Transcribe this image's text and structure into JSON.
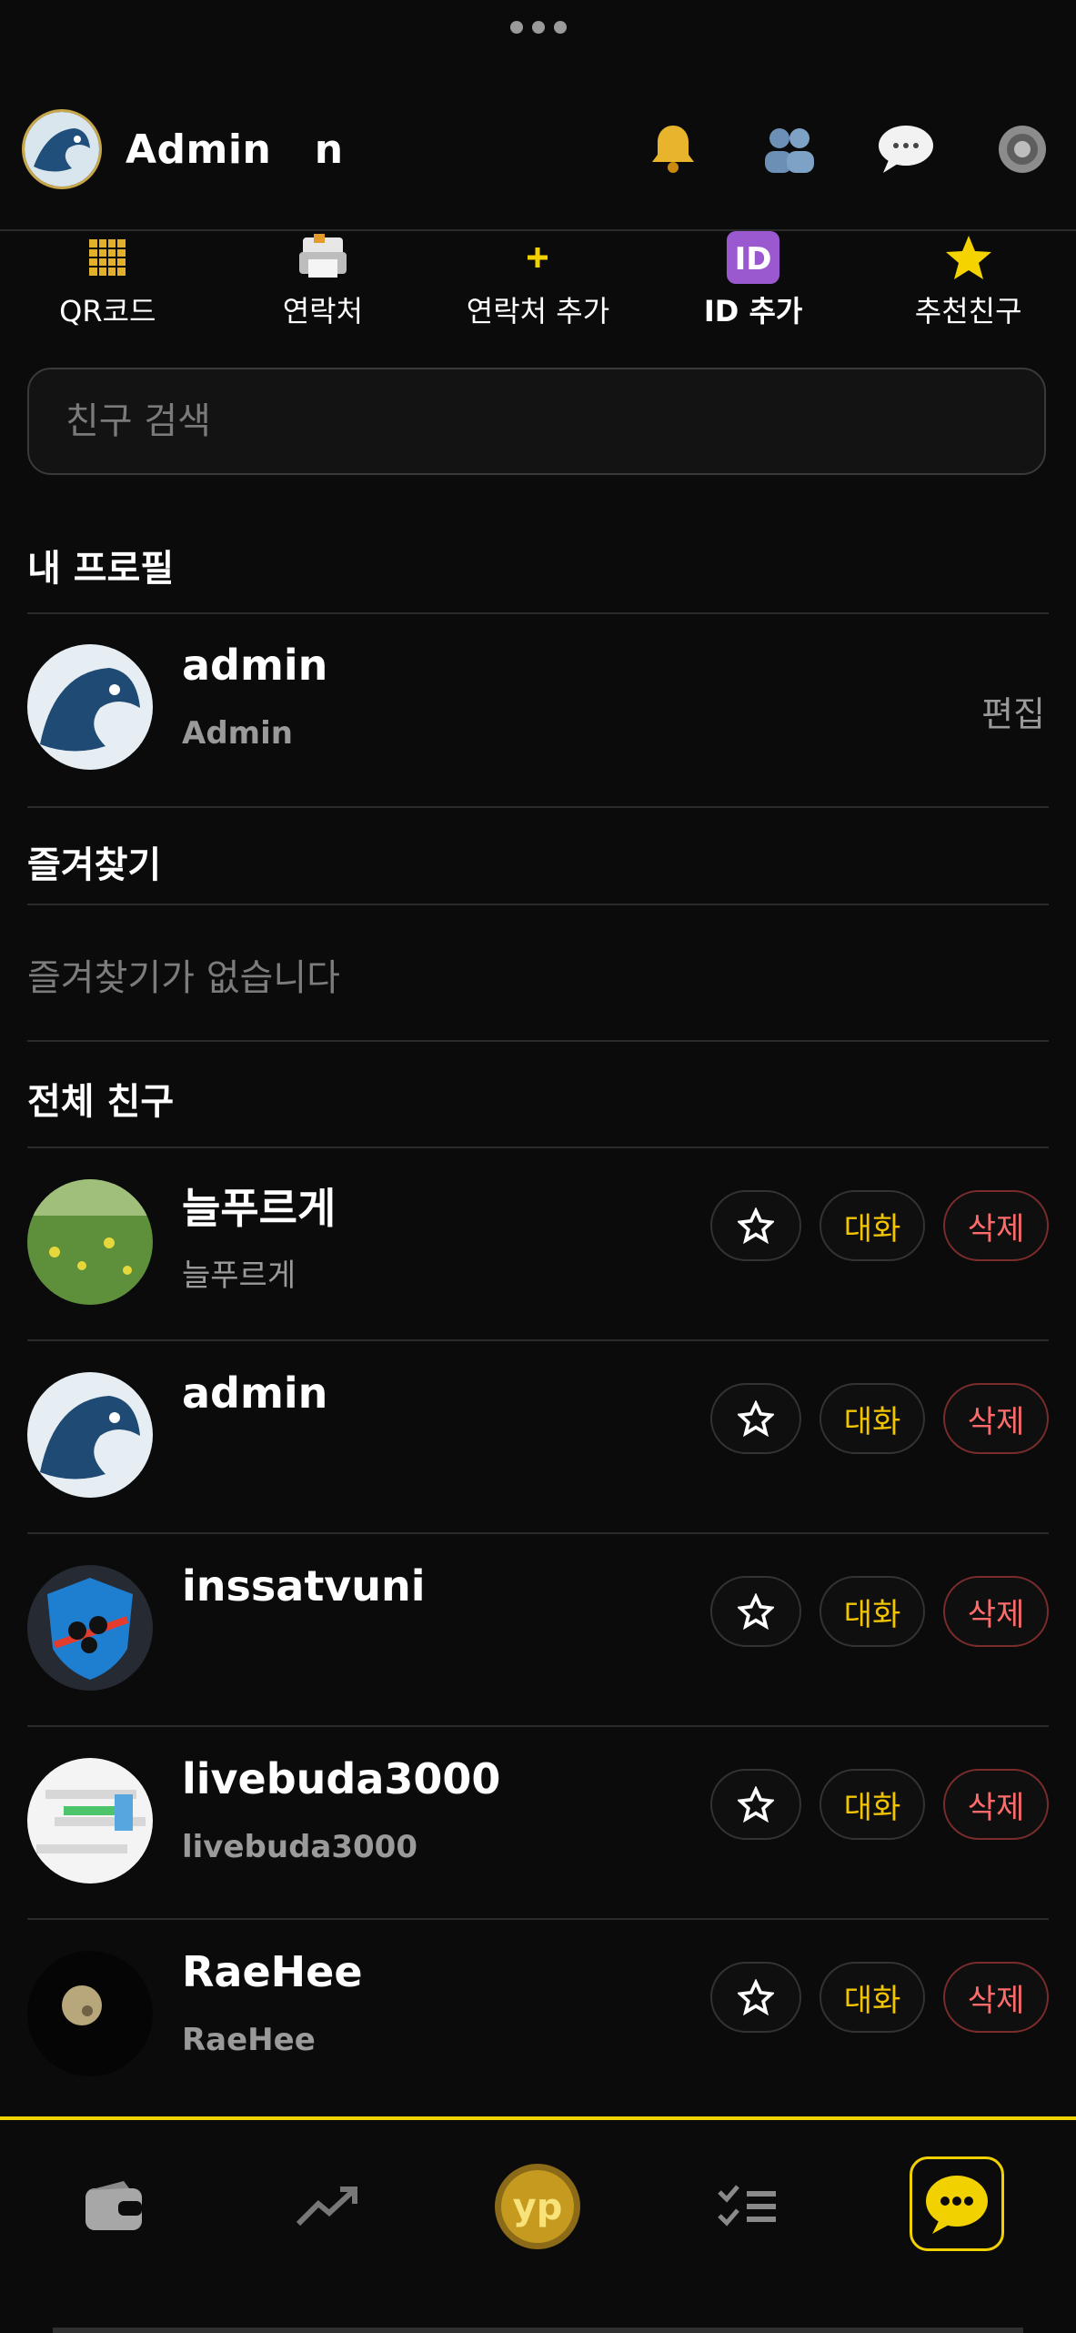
{
  "header": {
    "title": "Admin   n"
  },
  "quick_actions": [
    {
      "label": "QR코드",
      "icon": "qr-icon"
    },
    {
      "label": "연락처",
      "icon": "contacts-icon"
    },
    {
      "label": "연락처 추가",
      "icon": "plus-icon"
    },
    {
      "label": "ID 추가",
      "icon": "id-icon"
    },
    {
      "label": "추천친구",
      "icon": "star-icon"
    }
  ],
  "search": {
    "placeholder": "친구 검색"
  },
  "sections": {
    "my_profile": "내 프로필",
    "favorites": "즐겨찾기",
    "all_friends": "전체 친구"
  },
  "my_profile": {
    "name": "admin",
    "sub": "Admin",
    "edit_label": "편집"
  },
  "favorites_empty": "즐겨찾기가 없습니다",
  "friends": [
    {
      "name": "늘푸르게",
      "sub": "늘푸르게"
    },
    {
      "name": "admin",
      "sub": ""
    },
    {
      "name": "inssatvuni",
      "sub": ""
    },
    {
      "name": "livebuda3000",
      "sub": "livebuda3000"
    },
    {
      "name": "RaeHee",
      "sub": "RaeHee"
    }
  ],
  "friend_buttons": {
    "chat": "대화",
    "delete": "삭제"
  },
  "colors": {
    "accent": "#f2c500",
    "delete": "#ff6b6b",
    "background": "#0b0b0b"
  }
}
